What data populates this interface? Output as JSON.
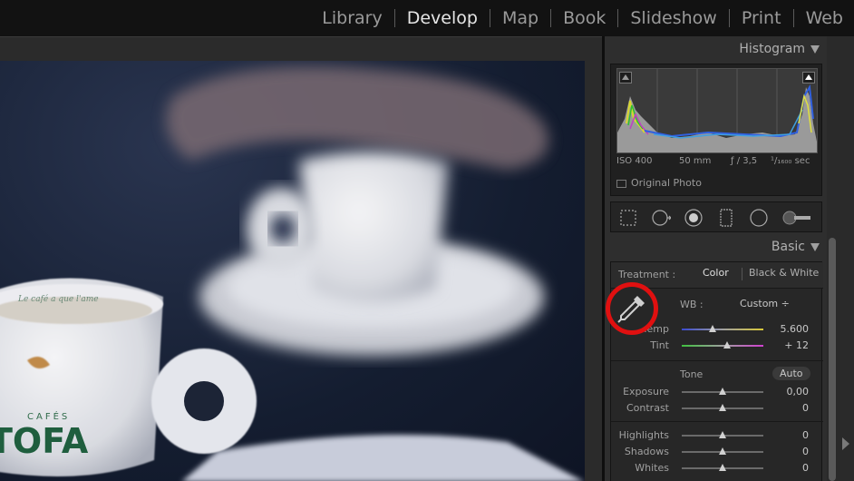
{
  "modules": [
    "Library",
    "Develop",
    "Map",
    "Book",
    "Slideshow",
    "Print",
    "Web"
  ],
  "active_module": "Develop",
  "histogram": {
    "title": "Histogram",
    "exif": {
      "iso": "ISO 400",
      "focal": "50 mm",
      "aperture": "ƒ / 3,5",
      "shutter": "¹/₁₆₀₀ sec"
    },
    "original_photo_label": "Original Photo"
  },
  "basic": {
    "title": "Basic",
    "treatment_label": "Treatment :",
    "treatment_color": "Color",
    "treatment_bw": "Black & White",
    "wb_label": "WB :",
    "wb_value": "Custom ÷",
    "temp_label": "Temp",
    "temp_value": "5.600",
    "temp_level": 0.38,
    "tint_label": "Tint",
    "tint_value": "+ 12",
    "tint_level": 0.56,
    "tone_label": "Tone",
    "auto_label": "Auto",
    "exposure_label": "Exposure",
    "exposure_value": "0,00",
    "contrast_label": "Contrast",
    "contrast_value": "0",
    "highlights_label": "Highlights",
    "highlights_value": "0",
    "shadows_label": "Shadows",
    "shadows_value": "0",
    "whites_label": "Whites",
    "whites_value": "0"
  },
  "photo_text": {
    "cup_brand_top": "CAFÉS",
    "cup_brand": "TOFA",
    "cup_rim_text": "Le café a que l'ame"
  },
  "colors": {
    "accent_red": "#e01010",
    "panel_bg": "#2e2e2e",
    "active_text": "#e6e6e6"
  }
}
